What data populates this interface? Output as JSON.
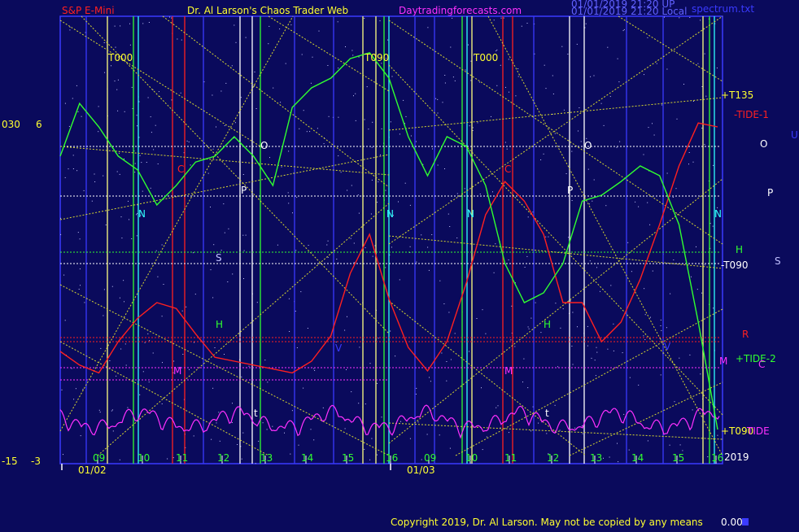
{
  "header": {
    "left_title": "S&P E-Mini",
    "center_title": "Dr. Al Larson's Chaos Trader Web",
    "site": "Daytradingforecasts.com",
    "stamp_line1": "01/01/2019 21:20 UP",
    "stamp_line2": "01/01/2019 21:20 Local",
    "right_title": "spectrum.txt"
  },
  "footer": {
    "copyright": "Copyright 2019, Dr. Al Larson. May not be copied by any means",
    "counter": "0.00"
  },
  "colors": {
    "background": "#0a0a5c",
    "frame": "#3a3aff",
    "red_line": "#ff2020",
    "green_line": "#30ff30",
    "magenta_line": "#ff30ff",
    "yellow_line": "#ffff30",
    "white_line": "#ffffff",
    "cyan": "#30ffff"
  },
  "chart_data": {
    "type": "line",
    "x_ticks": [
      "09",
      "10",
      "11",
      "12",
      "13",
      "14",
      "15",
      "16",
      "09",
      "10",
      "11",
      "12",
      "13",
      "14",
      "15",
      "16"
    ],
    "date_labels": [
      "01/02",
      "01/03"
    ],
    "year_label": "2019",
    "y_left_labels": [
      {
        "value": "030",
        "text": "030"
      },
      {
        "value": "6",
        "text": "6"
      },
      {
        "value": "-15",
        "text": "-15"
      },
      {
        "value": "-3",
        "text": "-3"
      }
    ],
    "right_labels": [
      "+T135",
      "-TIDE-1",
      "U",
      "O",
      "P",
      "H",
      "-T090",
      "S",
      "R",
      "+TIDE-2",
      "C",
      "+T090",
      "TIDE",
      "2019"
    ],
    "planet_letters": [
      "T000",
      "T090",
      "T000",
      "O",
      "P",
      "N",
      "S",
      "H",
      "M",
      "C",
      "t",
      "V",
      "N",
      "N",
      "O",
      "P",
      "N",
      "M",
      "H",
      "t",
      "V",
      "C",
      "M"
    ],
    "series": [
      {
        "name": "-TIDE-1",
        "color": "#ff2020",
        "values": [
          -0.55,
          -0.62,
          -0.66,
          -0.5,
          -0.38,
          -0.3,
          -0.33,
          -0.46,
          -0.58,
          -0.6,
          -0.62,
          -0.64,
          -0.66,
          -0.6,
          -0.47,
          -0.15,
          0.05,
          -0.28,
          -0.53,
          -0.65,
          -0.5,
          -0.2,
          0.15,
          0.32,
          0.22,
          0.05,
          -0.3,
          -0.3,
          -0.5,
          -0.4,
          -0.18,
          0.1,
          0.4,
          0.62,
          0.6
        ]
      },
      {
        "name": "+TIDE-2",
        "color": "#30ff30",
        "values": [
          0.45,
          0.72,
          0.6,
          0.45,
          0.38,
          0.2,
          0.3,
          0.42,
          0.45,
          0.55,
          0.45,
          0.3,
          0.7,
          0.8,
          0.85,
          0.95,
          0.98,
          0.85,
          0.55,
          0.35,
          0.55,
          0.5,
          0.3,
          -0.1,
          -0.3,
          -0.25,
          -0.1,
          0.22,
          0.25,
          0.32,
          0.4,
          0.35,
          0.1,
          -0.4,
          -0.95
        ]
      }
    ]
  }
}
